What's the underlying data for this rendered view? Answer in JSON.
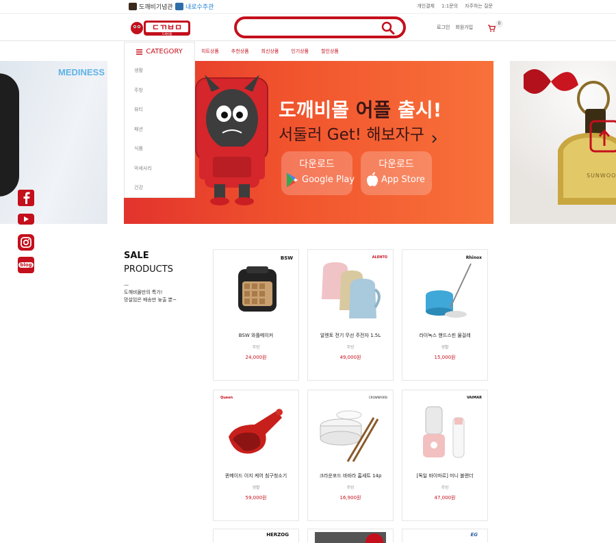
{
  "topbar": {
    "site_links": [
      "도깨비기념관",
      "내로수주관"
    ],
    "links": [
      "개인결제",
      "1:1문의",
      "자주하는 질문"
    ]
  },
  "header": {
    "logo_text": "도깨비몰",
    "search_placeholder": "",
    "login": "로그인",
    "join": "회원가입",
    "cart_count": "0"
  },
  "nav": {
    "category_label": "CATEGORY",
    "menu": [
      "히트상품",
      "추천상품",
      "최신상품",
      "인기상품",
      "할인상품"
    ]
  },
  "category_list": [
    "생활",
    "주방",
    "뷰티",
    "패션",
    "식품",
    "악세사리",
    "건강"
  ],
  "banner": {
    "left_brand": "MEDINESS",
    "title_a": "도깨비몰 ",
    "title_b": "어플",
    "title_c": " 출시!",
    "subtitle": "서둘러 Get! 해보자구",
    "btn1_top": "다운로드",
    "btn1_store": "Google Play",
    "btn2_top": "다운로드",
    "btn2_store": "App Store",
    "right_text": "SUNWOO"
  },
  "social": [
    "facebook-icon",
    "youtube-icon",
    "instagram-icon",
    "blog-icon"
  ],
  "social_blog_label": "blog",
  "sale": {
    "title1": "SALE",
    "title2": "PRODUCTS",
    "dash": "—",
    "desc1": "도깨비몰만의 특가!",
    "desc2": "망설임은 배송만 늦출 뿐~"
  },
  "products": [
    {
      "brand": "BSW",
      "name": "BSW 와플메이커",
      "category": "주방",
      "price": "24,000원"
    },
    {
      "brand": "ALENTO",
      "name": "알렌토 전기 무선 주전자 1.5L",
      "category": "주방",
      "price": "49,000원"
    },
    {
      "brand": "Rhinox",
      "name": "라이녹스 핸드스핀 물걸레",
      "category": "생활",
      "price": "15,000원"
    },
    {
      "brand": "Queen",
      "name": "퀸메이드 이지 케어 침구청소기",
      "category": "생활",
      "price": "59,000원"
    },
    {
      "brand": "CROWNFORD",
      "name": "크라운포드 바바라 홈세트 14p",
      "category": "주방",
      "price": "16,900원"
    },
    {
      "brand": "VAIMAR",
      "name": "[독일 바이마르] 미니 블렌더",
      "category": "주방",
      "price": "47,000원"
    }
  ],
  "partial_brands": [
    "HERZOG",
    "",
    "EG"
  ],
  "colors": {
    "brand_red": "#c40f1c",
    "banner_orange": "#f1542d"
  }
}
